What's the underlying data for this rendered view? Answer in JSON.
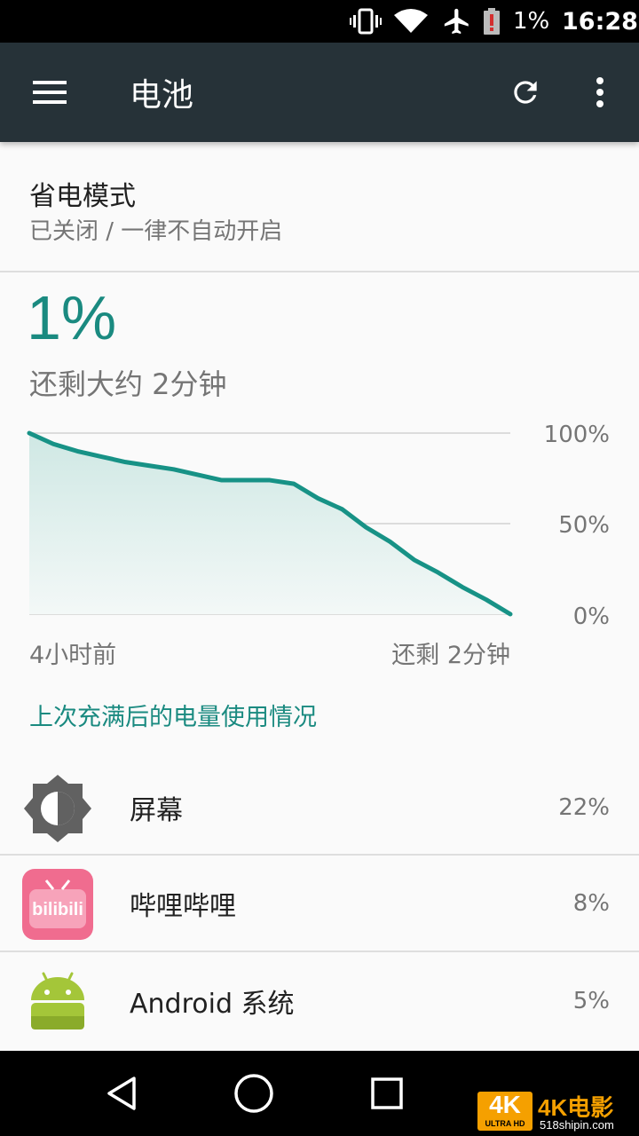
{
  "status_bar": {
    "battery_percent": "1%",
    "time": "16:28",
    "icons": [
      "vibrate-icon",
      "wifi-icon",
      "airplane-mode-icon",
      "battery-alert-icon"
    ]
  },
  "toolbar": {
    "title": "电池",
    "menu_icon": "hamburger-menu-icon",
    "refresh_icon": "refresh-icon",
    "overflow_icon": "more-vert-icon"
  },
  "battery_saver": {
    "title": "省电模式",
    "summary": "已关闭 / 一律不自动开启"
  },
  "battery": {
    "level": "1%",
    "remaining": "还剩大约 2分钟"
  },
  "chart_data": {
    "type": "area",
    "x": [
      0,
      5,
      10,
      15,
      20,
      25,
      30,
      35,
      40,
      45,
      50,
      55,
      60,
      65,
      70,
      75,
      80,
      85,
      90,
      95,
      100
    ],
    "values": [
      100,
      94,
      90,
      87,
      84,
      82,
      80,
      77,
      74,
      74,
      74,
      72,
      64,
      58,
      48,
      40,
      30,
      23,
      15,
      8,
      0
    ],
    "y_tick_labels": [
      "100%",
      "50%",
      "0%"
    ],
    "x_tick_labels": [
      "4小时前",
      "还剩 2分钟"
    ],
    "ylim": [
      0,
      100
    ],
    "grid": true,
    "line_color": "#179286"
  },
  "usage": {
    "header": "上次充满后的电量使用情况",
    "apps": [
      {
        "name": "屏幕",
        "percent": "22%",
        "icon": "brightness-icon"
      },
      {
        "name": "哔哩哔哩",
        "percent": "8%",
        "icon": "bilibili-app-icon",
        "icon_text": "bilibili"
      },
      {
        "name": "Android 系统",
        "percent": "5%",
        "icon": "android-robot-icon"
      }
    ]
  },
  "nav_bar": {
    "buttons": [
      "back-icon",
      "home-icon",
      "recents-icon"
    ]
  },
  "watermark": {
    "badge": "4K",
    "badge_sub": "ULTRA HD",
    "text": "4K电影",
    "site": "518shipin.com"
  },
  "colors": {
    "accent": "#1a8a80",
    "toolbar": "#263238",
    "status_bar": "#000000",
    "bilibili_pink": "#f06c8f",
    "android_green": "#a4c639"
  }
}
